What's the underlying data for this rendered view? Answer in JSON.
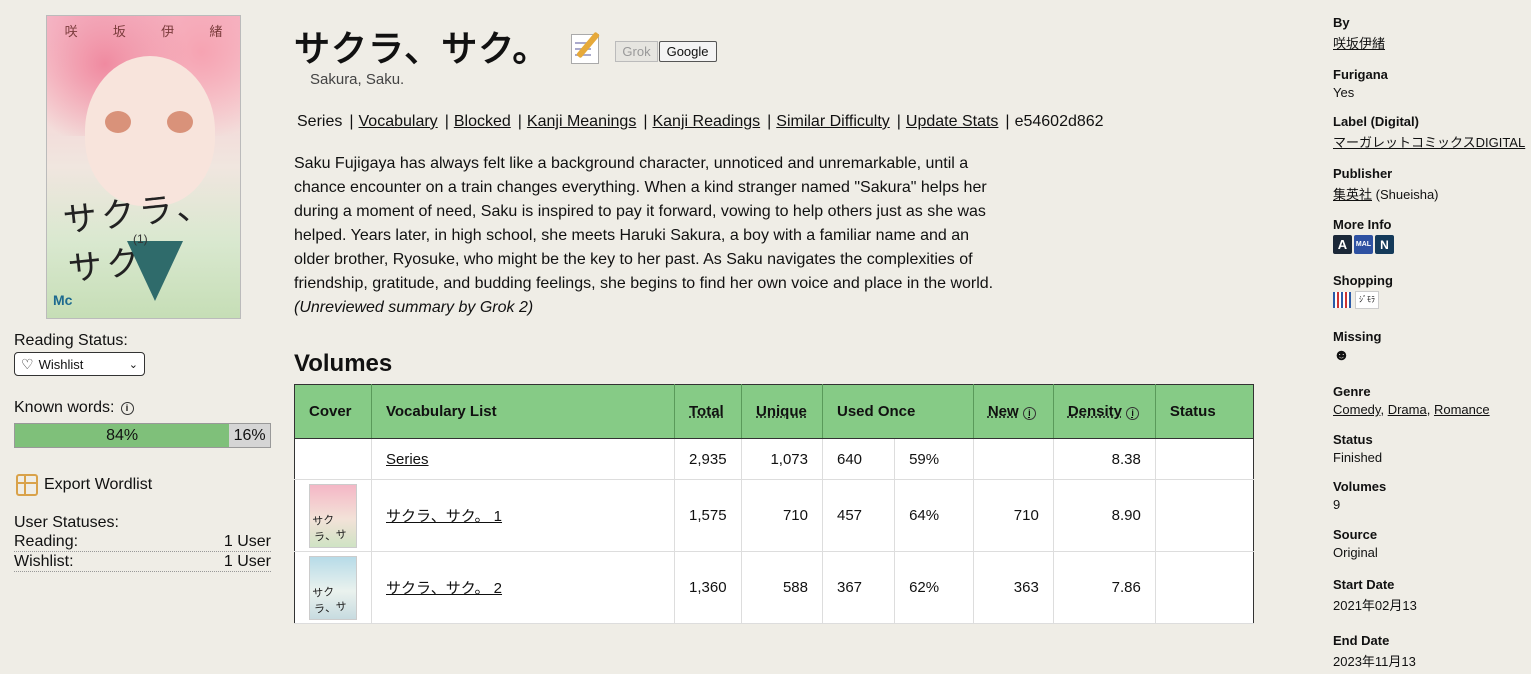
{
  "cover": {
    "author_chars": [
      "咲",
      "坂",
      "伊",
      "緒"
    ],
    "title_script": "サクラ、サク。",
    "volume_mark": "(1)",
    "publisher_logo": "Mc"
  },
  "reading_status": {
    "label": "Reading Status:",
    "selected": "Wishlist",
    "icon": "heart-icon"
  },
  "known_words": {
    "label": "Known words:",
    "known_percent": 84,
    "known_label": "84%",
    "unknown_label": "16%",
    "colors": {
      "known": "#7fc07a",
      "unknown": "#d5d5d5"
    }
  },
  "export": {
    "label": "Export Wordlist"
  },
  "user_statuses": {
    "label": "User Statuses:",
    "rows": [
      {
        "name": "Reading:",
        "count": "1 User"
      },
      {
        "name": "Wishlist:",
        "count": "1 User"
      }
    ]
  },
  "header": {
    "title": "サクラ、サク。",
    "romaji": "Sakura, Saku.",
    "grok_label": "Grok",
    "google_label": "Google"
  },
  "nav": {
    "current": "Series",
    "links": [
      "Vocabulary",
      "Blocked",
      "Kanji Meanings",
      "Kanji Readings",
      "Similar Difficulty",
      "Update Stats"
    ],
    "hash": "e54602d862"
  },
  "summary": {
    "text": "Saku Fujigaya has always felt like a background character, unnoticed and unremarkable, until a chance encounter on a train changes everything. When a kind stranger named \"Sakura\" helps her during a moment of need, Saku is inspired to pay it forward, vowing to help others just as she was helped. Years later, in high school, she meets Haruki Sakura, a boy with a familiar name and an older brother, Ryosuke, who might be the key to her past. As Saku navigates the complexities of friendship, gratitude, and budding feelings, she begins to find her own voice and place in the world.",
    "note": "(Unreviewed summary by Grok 2)"
  },
  "volumes": {
    "heading": "Volumes",
    "columns": {
      "cover": "Cover",
      "vocab": "Vocabulary List",
      "total": "Total",
      "unique": "Unique",
      "used_once": "Used Once",
      "new": "New",
      "density": "Density",
      "status": "Status"
    },
    "series_row": {
      "name": "Series",
      "total": "2,935",
      "unique": "1,073",
      "once": "640",
      "once_pct": "59%",
      "new": "",
      "density": "8.38",
      "status": ""
    },
    "rows": [
      {
        "name": "サクラ、サク。 1",
        "total": "1,575",
        "unique": "710",
        "once": "457",
        "once_pct": "64%",
        "new": "710",
        "density": "8.90",
        "status": ""
      },
      {
        "name": "サクラ、サク。 2",
        "total": "1,360",
        "unique": "588",
        "once": "367",
        "once_pct": "62%",
        "new": "363",
        "density": "7.86",
        "status": ""
      }
    ]
  },
  "sidebar": {
    "by": {
      "label": "By",
      "value": "咲坂伊緒"
    },
    "furigana": {
      "label": "Furigana",
      "value": "Yes"
    },
    "label_digital": {
      "label": "Label (Digital)",
      "value": "マーガレットコミックスDIGITAL"
    },
    "publisher": {
      "label": "Publisher",
      "value": "集英社",
      "romaji": "(Shueisha)"
    },
    "more_info": {
      "label": "More Info",
      "badges": [
        "A",
        "MAL",
        "N"
      ]
    },
    "shopping": {
      "label": "Shopping",
      "store2": "ｼﾞﾓﾗ"
    },
    "missing": {
      "label": "Missing"
    },
    "genre": {
      "label": "Genre",
      "values": [
        "Comedy",
        "Drama",
        "Romance"
      ],
      "sep": ","
    },
    "status": {
      "label": "Status",
      "value": "Finished"
    },
    "volumes": {
      "label": "Volumes",
      "value": "9"
    },
    "source": {
      "label": "Source",
      "value": "Original"
    },
    "start_date": {
      "label": "Start Date",
      "value": "2021年02月13"
    },
    "end_date": {
      "label": "End Date",
      "value": "2023年11月13"
    }
  }
}
